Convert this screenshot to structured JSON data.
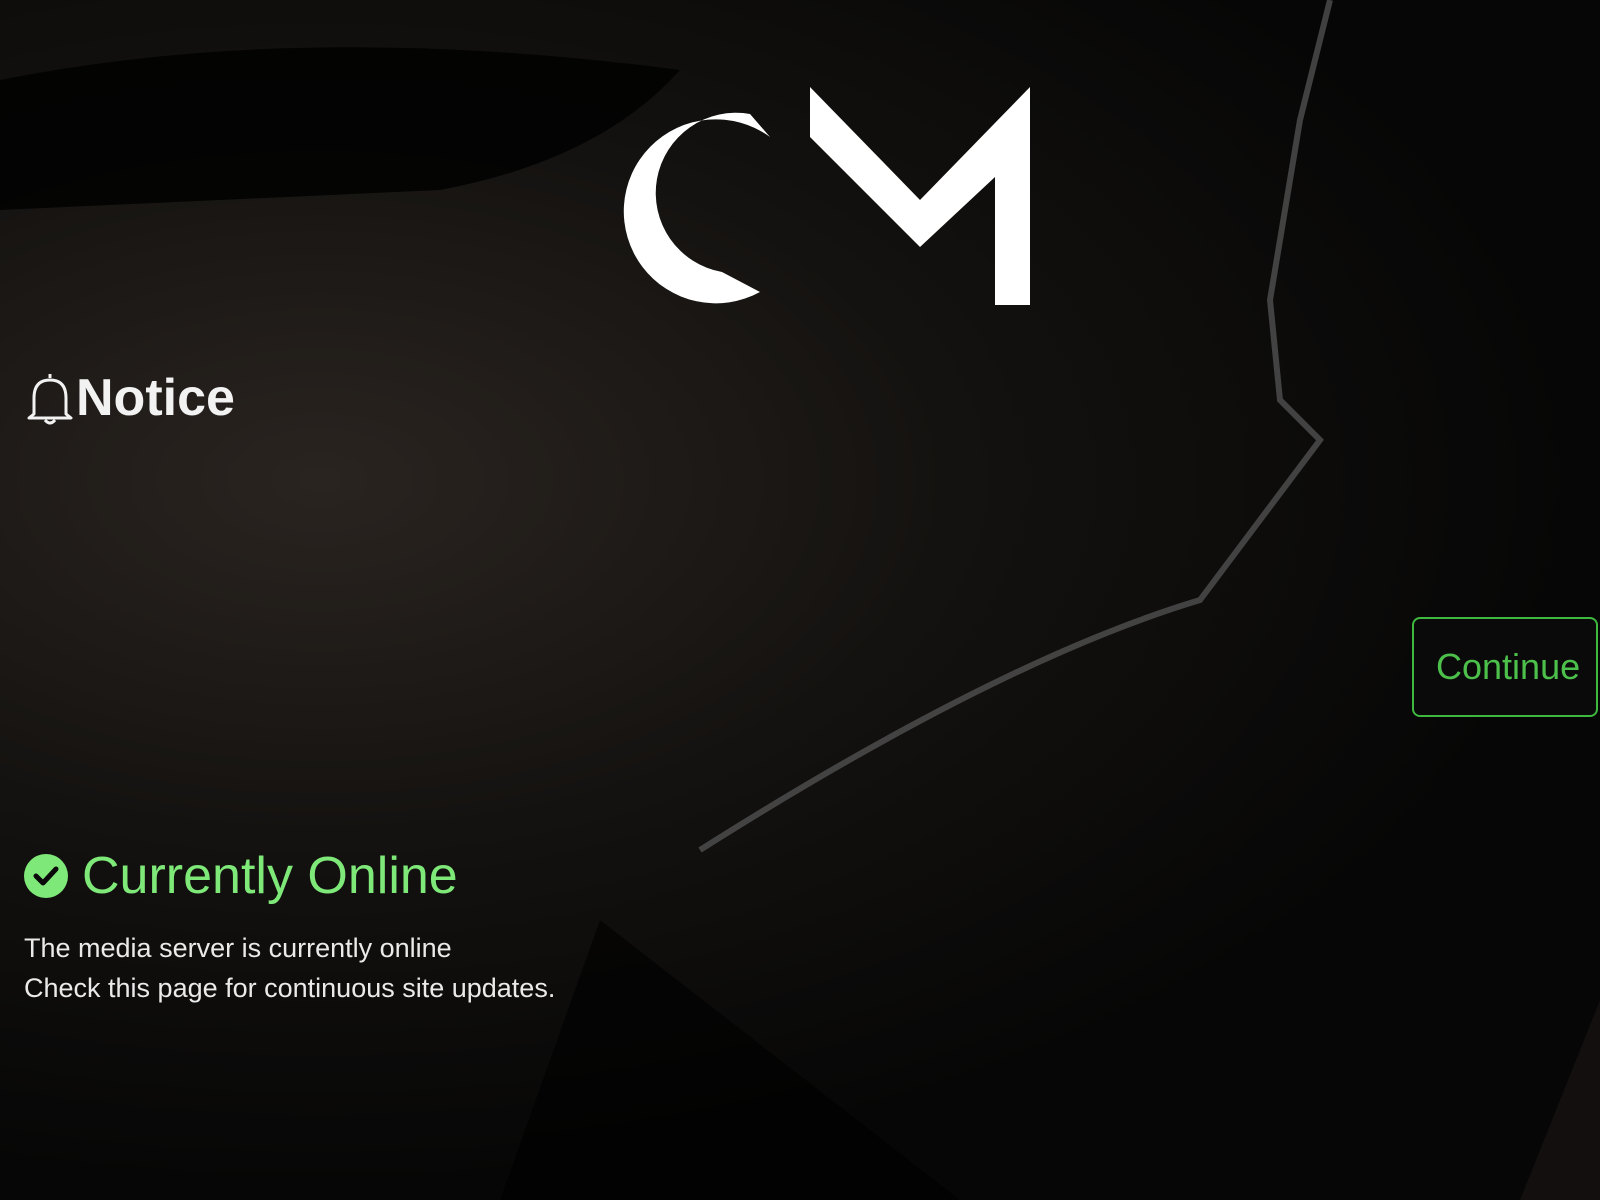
{
  "logo": {
    "text": "CM"
  },
  "notice": {
    "title": "Notice",
    "icon": "bell-icon"
  },
  "status": {
    "title": "Currently Online",
    "icon": "check-circle-icon",
    "color": "#7ee878"
  },
  "message": {
    "line1": "The media server is currently online",
    "line2": "Check this page for continuous site updates."
  },
  "button": {
    "label": "Continue",
    "color": "#3fb83f"
  }
}
